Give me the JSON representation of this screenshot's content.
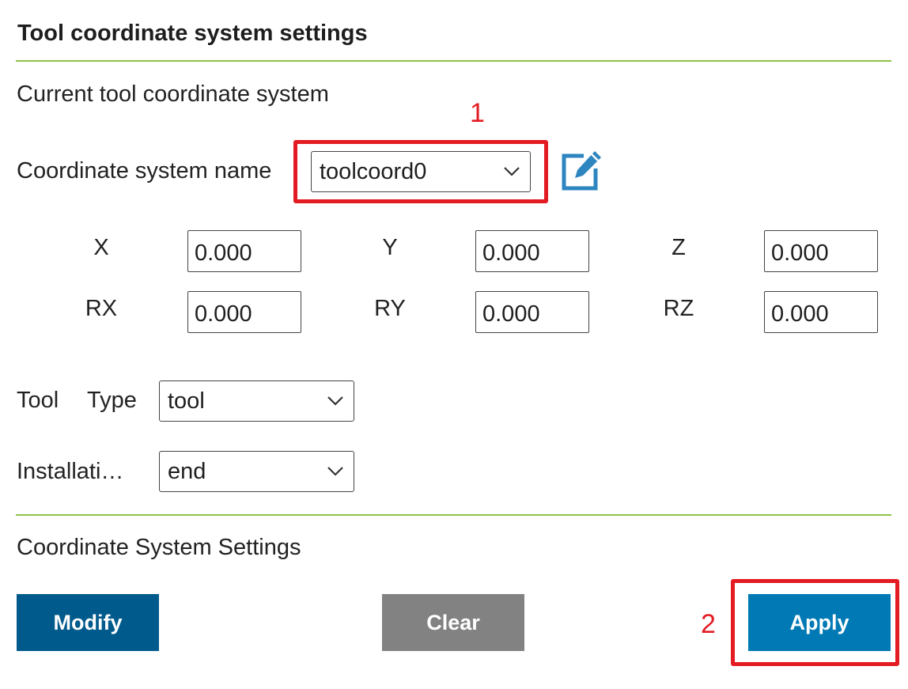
{
  "title": "Tool coordinate system settings",
  "current_section_label": "Current tool coordinate system",
  "coord_name": {
    "label": "Coordinate system name",
    "selected": "toolcoord0"
  },
  "edit_icon": "edit-pencil-icon",
  "coords": {
    "x": {
      "label": "X",
      "value": "0.000"
    },
    "y": {
      "label": "Y",
      "value": "0.000"
    },
    "z": {
      "label": "Z",
      "value": "0.000"
    },
    "rx": {
      "label": "RX",
      "value": "0.000"
    },
    "ry": {
      "label": "RY",
      "value": "0.000"
    },
    "rz": {
      "label": "RZ",
      "value": "0.000"
    }
  },
  "tool_type": {
    "label_word1": "Tool",
    "label_word2": "Type",
    "selected": "tool"
  },
  "installation": {
    "label": "Installati…",
    "selected": "end"
  },
  "settings_section_label": "Coordinate System Settings",
  "buttons": {
    "modify": "Modify",
    "clear": "Clear",
    "apply": "Apply"
  },
  "annotations": {
    "step1": "1",
    "step2": "2"
  },
  "colors": {
    "divider": "#8cc44a",
    "modify_bg": "#005b8c",
    "clear_bg": "#828282",
    "apply_bg": "#0079b5",
    "highlight": "#e31b23",
    "edit_icon": "#2e86c1"
  }
}
